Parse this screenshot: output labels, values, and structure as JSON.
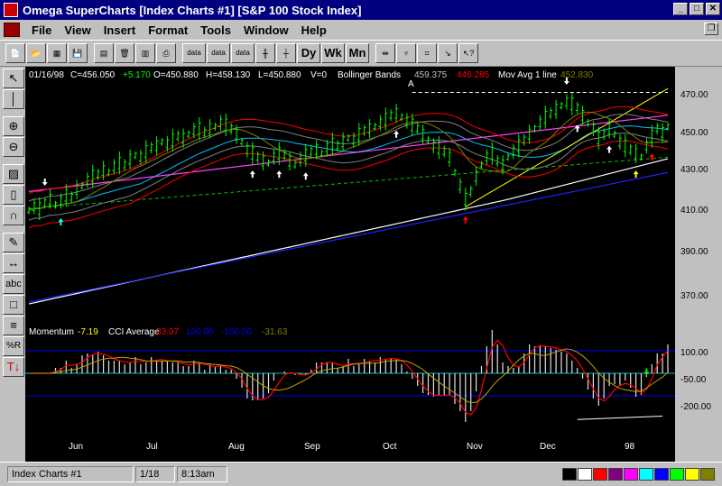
{
  "window": {
    "title": "Omega SuperCharts  [Index Charts #1] [S&P 100 Stock Index]"
  },
  "menu": [
    "File",
    "View",
    "Insert",
    "Format",
    "Tools",
    "Window",
    "Help"
  ],
  "toolbar": {
    "buttons": [
      "data",
      "data",
      "data",
      "Dy",
      "Wk",
      "Mn"
    ]
  },
  "chart_data": {
    "type": "candlestick",
    "header": {
      "date": "01/16/98",
      "close": "C=456.050",
      "change": "+5.170",
      "open": "O=450.880",
      "high": "H=458.130",
      "low": "L=450.880",
      "volume": "V=0",
      "bollinger_label": "Bollinger Bands",
      "bollinger_upper": "459.375",
      "bollinger_lower": "446.285",
      "ma_label": "Mov Avg 1 line",
      "ma_value": "452.830"
    },
    "price_axis": {
      "ticks": [
        "470.00",
        "450.00",
        "430.00",
        "410.00",
        "390.00",
        "370.00"
      ]
    },
    "indicator": {
      "label": "Momentum",
      "momentum_value": "-7.19",
      "cci_label": "CCI Average",
      "cci_value": "33.97",
      "level_hi": "100.00",
      "level_lo": "-100.00",
      "avg_value": "-31.63",
      "ticks": [
        "100.00",
        "-50.00",
        "-200.00"
      ]
    },
    "x_labels": [
      "Jun",
      "Jul",
      "Aug",
      "Sep",
      "Oct",
      "Nov",
      "Dec",
      "98"
    ],
    "annotation": "A",
    "ylim": [
      355,
      478
    ],
    "prices": [
      412,
      414,
      413,
      416,
      418,
      415,
      417,
      420,
      419,
      423,
      425,
      428,
      430,
      431,
      433,
      432,
      435,
      437,
      436,
      439,
      441,
      440,
      443,
      445,
      446,
      448,
      447,
      449,
      451,
      450,
      452,
      454,
      455,
      453,
      455,
      456,
      458,
      457,
      455,
      452,
      448,
      444,
      442,
      440,
      438,
      437,
      440,
      442,
      441,
      438,
      436,
      439,
      441,
      443,
      444,
      442,
      445,
      447,
      446,
      448,
      450,
      449,
      452,
      454,
      455,
      456,
      458,
      460,
      462,
      463,
      461,
      459,
      457,
      455,
      452,
      449,
      446,
      445,
      443,
      440,
      432,
      425,
      418,
      422,
      430,
      436,
      440,
      442,
      438,
      436,
      440,
      443,
      446,
      449,
      452,
      455,
      458,
      461,
      463,
      465,
      467,
      469,
      468,
      466,
      462,
      458,
      455,
      450,
      452,
      455,
      452,
      448,
      446,
      444,
      442,
      440,
      446,
      451,
      455,
      453,
      456
    ]
  },
  "statusbar": {
    "name": "Index Charts #1",
    "date": "1/18",
    "time": "8:13am"
  },
  "palette": [
    "#000000",
    "#ffffff",
    "#ff0000",
    "#800080",
    "#ff00ff",
    "#00ffff",
    "#0000ff",
    "#00ff00",
    "#ffff00",
    "#808000"
  ]
}
